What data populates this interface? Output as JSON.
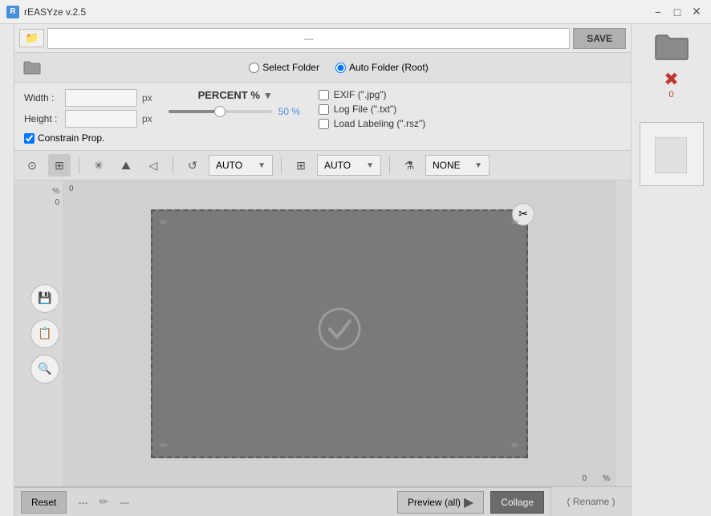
{
  "title_bar": {
    "title": "rEASYze v.2.5",
    "icon": "R",
    "min_label": "−",
    "max_label": "□",
    "close_label": "✕"
  },
  "top_bar": {
    "path_placeholder": "---",
    "save_label": "SAVE"
  },
  "folder_bar": {
    "select_folder_label": "Select Folder",
    "auto_folder_label": "Auto Folder (Root)"
  },
  "settings": {
    "width_label": "Width :",
    "height_label": "Height :",
    "px_label": "px",
    "constrain_label": "Constrain Prop.",
    "percent_label": "PERCENT %",
    "slider_value": "50 %",
    "exif_label": "EXIF (\".jpg\")",
    "log_label": "Log File (\".txt\")",
    "load_labeling_label": "Load Labeling (\".rsz\")"
  },
  "toolbar": {
    "rotate_auto_label": "AUTO",
    "resize_auto_label": "AUTO",
    "filter_label": "NONE",
    "rotate_icon": "↺",
    "resize_icon": "⊞",
    "filter_icon": "⚗"
  },
  "canvas": {
    "top_ruler_value": "0",
    "left_ruler_label": "%",
    "left_ruler_value": "0",
    "bottom_ruler_value": "0",
    "bottom_ruler_pct": "%"
  },
  "bottom_bar": {
    "reset_label": "Reset",
    "dots1": "---",
    "pencil": "✏",
    "dots2": "---",
    "preview_label": "Preview (all)",
    "collage_label": "Collage",
    "rename_label": "( Rename )"
  },
  "right_sidebar": {
    "error_count": "0"
  }
}
